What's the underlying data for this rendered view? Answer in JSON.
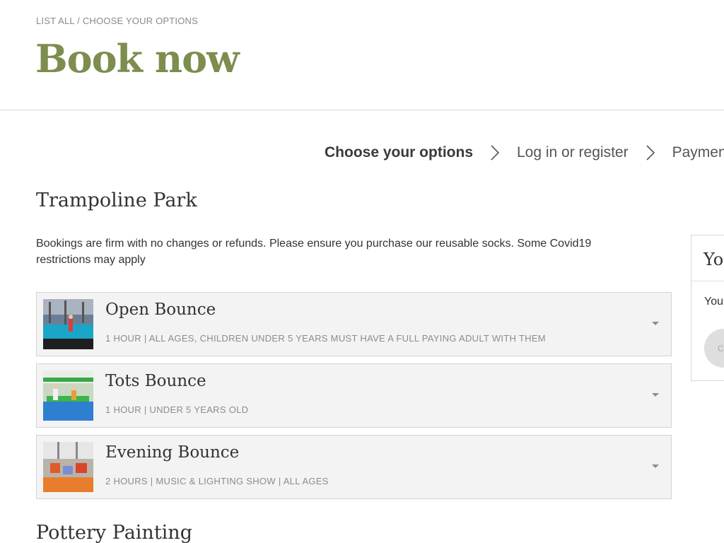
{
  "breadcrumb": {
    "list_all": "LIST ALL",
    "separator": " / ",
    "current": "CHOOSE YOUR OPTIONS"
  },
  "header": {
    "title": "Book now"
  },
  "steps": [
    {
      "label": "Choose your options"
    },
    {
      "label": "Log in or register"
    },
    {
      "label": "Payment"
    }
  ],
  "sections": [
    {
      "title": "Trampoline Park",
      "description": "Bookings are firm with no changes or refunds. Please ensure you purchase our reusable socks. Some Covid19 restrictions may apply",
      "products": [
        {
          "name": "Open Bounce",
          "meta": "1 HOUR | ALL AGES, CHILDREN UNDER 5 YEARS MUST HAVE A FULL PAYING ADULT WITH THEM",
          "icon": "trampoline-photo"
        },
        {
          "name": "Tots Bounce",
          "meta": "1 HOUR | UNDER 5 YEARS OLD",
          "icon": "trampoline-photo"
        },
        {
          "name": "Evening Bounce",
          "meta": "2 HOURS | MUSIC & LIGHTING SHOW | ALL AGES",
          "icon": "trampoline-photo"
        }
      ]
    },
    {
      "title": "Pottery Painting"
    }
  ],
  "cart": {
    "title": "Yo",
    "text": "You",
    "button": "C"
  },
  "colors": {
    "title_green": "#7c8d4e",
    "card_bg": "#f3f3f3",
    "card_border": "#d3d3d3",
    "muted_text": "#8c8c8c"
  }
}
